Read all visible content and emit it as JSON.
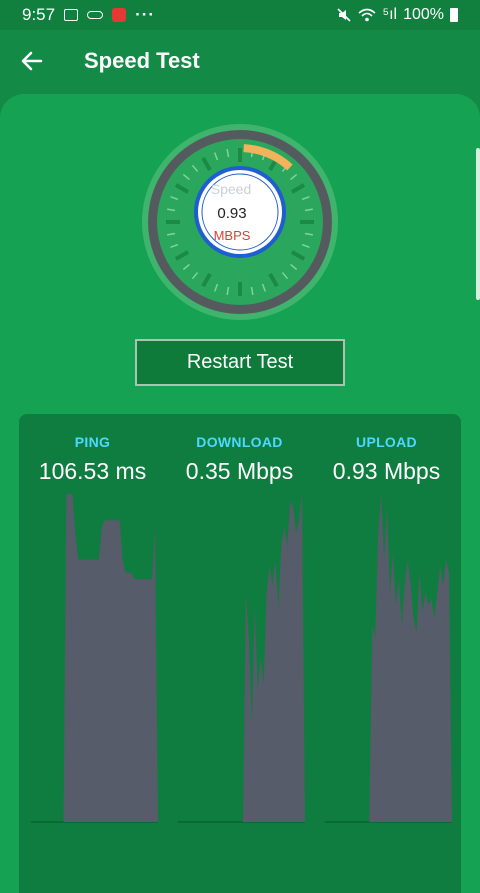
{
  "status_bar": {
    "time": "9:57",
    "more": "···",
    "signal_text": "⁵ıl",
    "battery": "100%"
  },
  "app_bar": {
    "title": "Speed Test",
    "back_icon": "arrow-back-icon"
  },
  "gauge": {
    "label": "Speed",
    "value": "0.93",
    "unit": "MBPS",
    "level_fraction": 0.1,
    "colors": {
      "outer": "#555a5f",
      "face": "#2aa75c",
      "needle_arc": "#f2b35b",
      "ring": "#1e5ed1",
      "unit": "#d64232"
    }
  },
  "restart_button": {
    "label": "Restart Test"
  },
  "stats": [
    {
      "label": "PING",
      "value": "106.53 ms"
    },
    {
      "label": "DOWNLOAD",
      "value": "0.35 Mbps"
    },
    {
      "label": "UPLOAD",
      "value": "0.93 Mbps"
    }
  ],
  "chart_data": [
    {
      "type": "area",
      "name": "ping",
      "values": [
        0,
        0,
        0,
        0,
        0,
        0,
        0,
        0,
        0,
        0,
        0,
        0,
        100,
        100,
        100,
        88,
        80,
        80,
        80,
        80,
        80,
        80,
        80,
        80,
        90,
        92,
        92,
        92,
        92,
        92,
        92,
        80,
        76,
        76,
        76,
        74,
        74,
        74,
        74,
        74,
        74,
        74,
        90,
        0
      ],
      "color": "#565c69"
    },
    {
      "type": "area",
      "name": "download",
      "values": [
        0,
        0,
        0,
        0,
        0,
        0,
        0,
        0,
        0,
        0,
        0,
        0,
        0,
        0,
        0,
        0,
        0,
        0,
        0,
        0,
        0,
        0,
        0,
        70,
        55,
        30,
        66,
        40,
        50,
        42,
        70,
        78,
        72,
        80,
        65,
        85,
        90,
        84,
        98,
        96,
        88,
        92,
        100,
        0
      ],
      "color": "#565c69"
    },
    {
      "type": "area",
      "name": "upload",
      "values": [
        0,
        0,
        0,
        0,
        0,
        0,
        0,
        0,
        0,
        0,
        0,
        0,
        0,
        0,
        0,
        0,
        60,
        56,
        88,
        100,
        80,
        96,
        70,
        82,
        66,
        74,
        60,
        72,
        80,
        72,
        62,
        58,
        76,
        64,
        70,
        66,
        68,
        62,
        70,
        78,
        72,
        80,
        76,
        0
      ],
      "color": "#565c69"
    }
  ]
}
